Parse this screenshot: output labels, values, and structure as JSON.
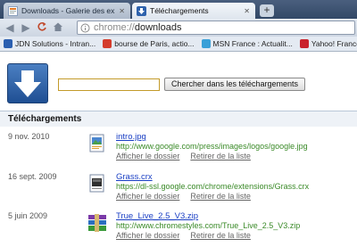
{
  "tabs": [
    {
      "title": "Downloads - Galerie des ex",
      "active": false
    },
    {
      "title": "Téléchargements",
      "active": true
    }
  ],
  "new_tab_label": "+",
  "omnibox": {
    "scheme": "chrome://",
    "path": "downloads"
  },
  "bookmarks": [
    {
      "label": "JDN Solutions - Intran...",
      "icon": "jdn-icon",
      "color": "#2b5fb0"
    },
    {
      "label": "bourse de Paris, actio...",
      "icon": "bourse-icon",
      "color": "#d43c2c"
    },
    {
      "label": "MSN France : Actualit...",
      "icon": "msn-icon",
      "color": "#3aa0d8"
    },
    {
      "label": "Yahoo! France",
      "icon": "yahoo-icon",
      "color": "#c9232d"
    }
  ],
  "search": {
    "value": "",
    "button_label": "Chercher dans les téléchargements"
  },
  "section_title": "Téléchargements",
  "downloads": [
    {
      "date": "9 nov. 2010",
      "name": "intro.jpg",
      "url": "http://www.google.com/press/images/logos/google.jpg",
      "icon": "image-file-icon",
      "show_folder": "Afficher le dossier",
      "remove": "Retirer de la liste"
    },
    {
      "date": "16 sept. 2009",
      "name": "Grass.crx",
      "url": "https://dl-ssl.google.com/chrome/extensions/Grass.crx",
      "icon": "extension-file-icon",
      "show_folder": "Afficher le dossier",
      "remove": "Retirer de la liste"
    },
    {
      "date": "5 juin 2009",
      "name": "True_Live_2.5_V3.zip",
      "url": "http://www.chromestyles.com/True_Live_2.5_V3.zip",
      "icon": "archive-file-icon",
      "show_folder": "Afficher le dossier",
      "remove": "Retirer de la liste"
    }
  ],
  "colors": {
    "link": "#1a3fc4",
    "url": "#3a8a28",
    "accent": "#2a5ea8"
  }
}
